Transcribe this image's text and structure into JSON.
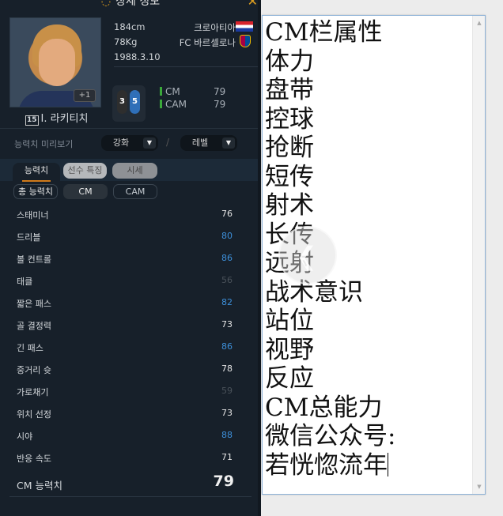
{
  "panel": {
    "title": "상세 정보",
    "title_icon": "speech-bubble-icon",
    "close_icon": "close-icon"
  },
  "player": {
    "plus_badge": "+1",
    "shirt_number": "15",
    "name": "I. 라키티치",
    "height": "184cm",
    "weight": "78Kg",
    "birth": "1988.3.10",
    "nation": "크로아티아",
    "club": "FC 바르셀로나",
    "foot_left": "3",
    "foot_right": "5",
    "positions": [
      {
        "pos": "CM",
        "rating": "79"
      },
      {
        "pos": "CAM",
        "rating": "79"
      }
    ]
  },
  "controls": {
    "preview_label": "능력치 미리보기",
    "enhance_label": "강화",
    "level_label": "레벨",
    "separator": "/"
  },
  "tabs": [
    {
      "label": "능력치",
      "active": true
    },
    {
      "label": "선수 특징",
      "active": false
    },
    {
      "label": "시세",
      "active": false
    }
  ],
  "chips": [
    {
      "label": "총 능력치"
    },
    {
      "label": "CM",
      "active": true
    },
    {
      "label": "CAM"
    }
  ],
  "stats": [
    {
      "name": "스태미너",
      "value": "76",
      "level": "normal"
    },
    {
      "name": "드리블",
      "value": "80",
      "level": "high"
    },
    {
      "name": "볼 컨트롤",
      "value": "86",
      "level": "high"
    },
    {
      "name": "태클",
      "value": "56",
      "level": "low"
    },
    {
      "name": "짧은 패스",
      "value": "82",
      "level": "high"
    },
    {
      "name": "골 결정력",
      "value": "73",
      "level": "normal"
    },
    {
      "name": "긴 패스",
      "value": "86",
      "level": "high"
    },
    {
      "name": "중거리 슛",
      "value": "78",
      "level": "normal"
    },
    {
      "name": "가로채기",
      "value": "59",
      "level": "low"
    },
    {
      "name": "위치 선정",
      "value": "73",
      "level": "normal"
    },
    {
      "name": "시야",
      "value": "88",
      "level": "high"
    },
    {
      "name": "반응 속도",
      "value": "71",
      "level": "normal"
    }
  ],
  "overall": {
    "label": "CM 능력치",
    "value": "79"
  },
  "colors": {
    "high": "#3d8fd9",
    "low": "#4a525a",
    "normal": "#e4e4e4",
    "panel_bg": "#17202a"
  },
  "editor": {
    "lines": [
      "CM栏属性",
      "体力",
      "盘带",
      "控球",
      "抢断",
      "短传",
      "射术",
      "长传",
      "远射",
      "战术意识",
      "站位",
      "视野",
      "反应",
      "CM总能力",
      "微信公众号:",
      "若恍惚流年"
    ]
  }
}
